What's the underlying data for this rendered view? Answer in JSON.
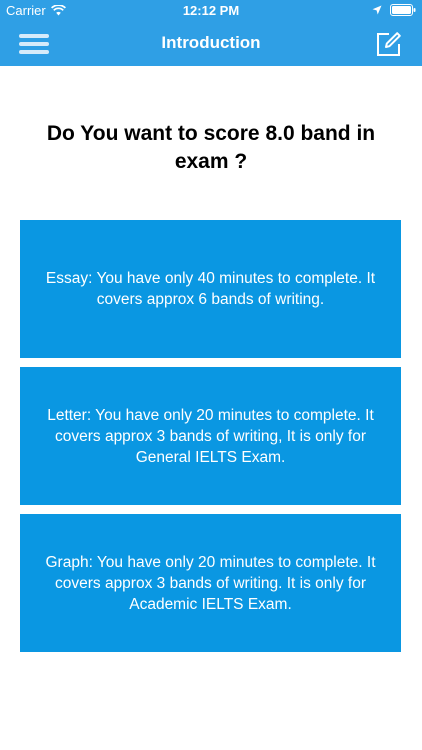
{
  "status_bar": {
    "carrier": "Carrier",
    "time": "12:12 PM"
  },
  "header": {
    "title": "Introduction",
    "menu_icon": "hamburger-menu-icon",
    "edit_icon": "compose-edit-icon",
    "background_color": "#2f9fe5"
  },
  "main": {
    "heading": "Do You want to score 8.0 band in exam ?",
    "cards": [
      {
        "text": "Essay: You have only 40 minutes to complete. It covers approx 6 bands of writing."
      },
      {
        "text": "Letter: You have only 20 minutes to complete. It covers approx 3 bands of writing, It is only for General IELTS Exam."
      },
      {
        "text": "Graph: You have only 20 minutes to complete. It covers approx 3 bands of writing. It is only for Academic IELTS Exam."
      }
    ],
    "card_color": "#0a97e2"
  }
}
